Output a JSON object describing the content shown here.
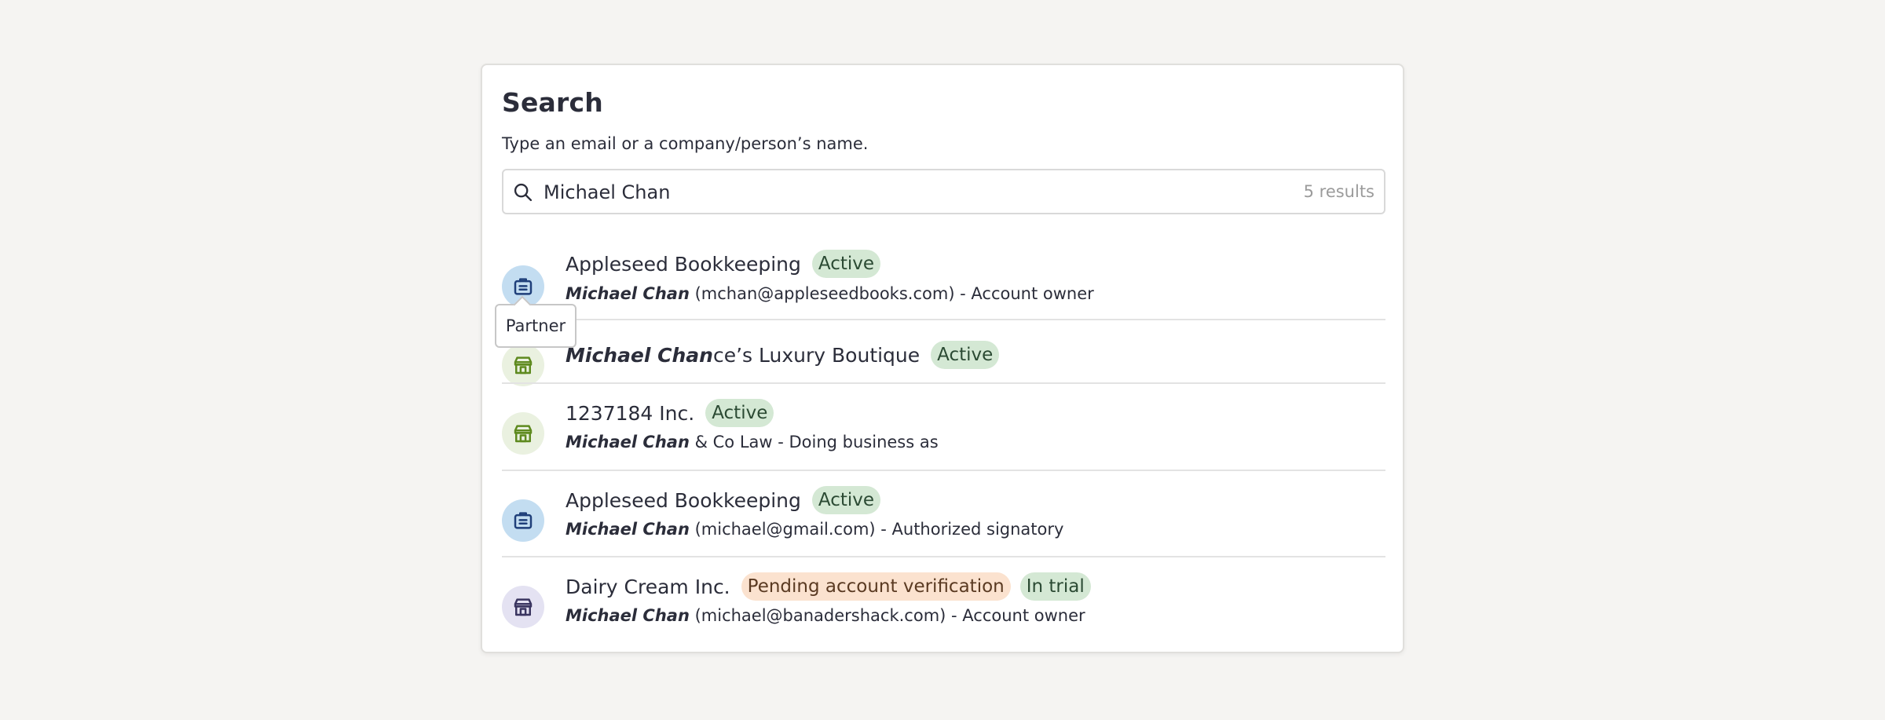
{
  "panel": {
    "title": "Search",
    "subtitle": "Type an email or a company/person’s name."
  },
  "search": {
    "value": "Michael Chan",
    "result_count": "5 results",
    "icon": "search-icon"
  },
  "tooltip": {
    "text": "Partner"
  },
  "results": [
    {
      "type": "partner",
      "icon": "briefcase-icon",
      "name": "Appleseed Bookkeeping",
      "badges": [
        "Active"
      ],
      "sub_match": "Michael Chan",
      "sub_rest": " (mchan@appleseedbooks.com) - Account owner"
    },
    {
      "type": "merchant",
      "icon": "storefront-icon",
      "name_match": "Michael Chan",
      "name_rest": "ce’s Luxury Boutique",
      "badges": [
        "Active"
      ]
    },
    {
      "type": "merchant",
      "icon": "storefront-icon",
      "name": "1237184 Inc.",
      "badges": [
        "Active"
      ],
      "sub_match": "Michael Chan",
      "sub_rest": " & Co Law - Doing business as"
    },
    {
      "type": "partner",
      "icon": "briefcase-icon",
      "name": "Appleseed Bookkeeping",
      "badges": [
        "Active"
      ],
      "sub_match": "Michael Chan",
      "sub_rest": " (michael@gmail.com) - Authorized signatory"
    },
    {
      "type": "merchant",
      "icon": "storefront-icon",
      "name": "Dairy Cream Inc.",
      "badges": [
        "Pending account verification",
        "In trial"
      ],
      "sub_match": "Michael Chan",
      "sub_rest": " (michael@banadershack.com) - Account owner"
    }
  ],
  "colors": {
    "background": "#f5f4f2",
    "text": "#2b2d3a",
    "partner_avatar": "#c3ddf1",
    "partner_icon": "#1f3f7a",
    "merchant_avatar": "#eaf1e0",
    "merchant_icon": "#5e8a1f",
    "merchant_purple_avatar": "#e4e2f2",
    "merchant_purple_icon": "#3a3560",
    "badge_green": "#d4e8d4",
    "badge_orange": "#fbe2cf",
    "muted": "#9b9b9b"
  }
}
